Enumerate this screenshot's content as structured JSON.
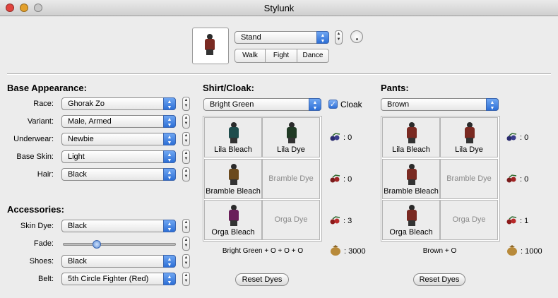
{
  "window": {
    "title": "Stylunk"
  },
  "preview": {
    "pose": "Stand",
    "pose_buttons": [
      "Walk",
      "Fight",
      "Dance"
    ]
  },
  "base_appearance": {
    "header": "Base Appearance:",
    "rows": [
      {
        "label": "Race:",
        "value": "Ghorak Zo"
      },
      {
        "label": "Variant:",
        "value": "Male, Armed"
      },
      {
        "label": "Underwear:",
        "value": "Newbie"
      },
      {
        "label": "Base Skin:",
        "value": "Light"
      },
      {
        "label": "Hair:",
        "value": "Black"
      }
    ]
  },
  "accessories": {
    "header": "Accessories:",
    "skin_dye": {
      "label": "Skin Dye:",
      "value": "Black"
    },
    "fade": {
      "label": "Fade:",
      "value": 0.28
    },
    "shoes": {
      "label": "Shoes:",
      "value": "Black"
    },
    "belt": {
      "label": "Belt:",
      "value": "5th Circle Fighter (Red)"
    }
  },
  "shirt": {
    "header": "Shirt/Cloak:",
    "color": "Bright Green",
    "cloak_label": "Cloak",
    "cloak_checked": true,
    "dyes": [
      {
        "left": "Lila Bleach",
        "right": "Lila Dye",
        "right_enabled": true,
        "count": ": 0",
        "body_color": "#1f4d4d"
      },
      {
        "left": "Bramble Bleach",
        "right": "Bramble Dye",
        "right_enabled": false,
        "count": ": 0",
        "body_color": "#6b4a1e"
      },
      {
        "left": "Orga Bleach",
        "right": "Orga Dye",
        "right_enabled": false,
        "count": ": 3",
        "body_color": "#6a1f5a"
      }
    ],
    "summary": "Bright Green + O + O + O",
    "cost": ": 3000",
    "reset": "Reset Dyes"
  },
  "pants": {
    "header": "Pants:",
    "color": "Brown",
    "dyes": [
      {
        "left": "Lila Bleach",
        "right": "Lila Dye",
        "right_enabled": true,
        "count": ": 0"
      },
      {
        "left": "Bramble Bleach",
        "right": "Bramble Dye",
        "right_enabled": false,
        "count": ": 0"
      },
      {
        "left": "Orga Bleach",
        "right": "Orga Dye",
        "right_enabled": false,
        "count": ": 1"
      }
    ],
    "summary": "Brown + O",
    "cost": ": 1000",
    "reset": "Reset Dyes"
  }
}
